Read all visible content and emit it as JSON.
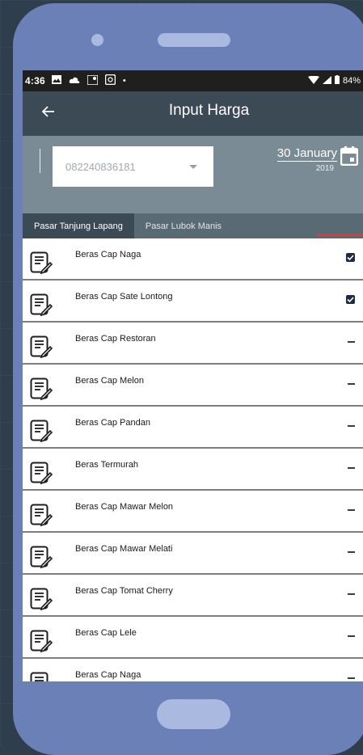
{
  "status": {
    "time": "4:36",
    "battery": "84%"
  },
  "appbar": {
    "title": "Input Harga"
  },
  "filter": {
    "phone": "082240836181",
    "date_main": "30 January",
    "date_year": "2019"
  },
  "tabs": [
    {
      "label": "Pasar Tanjung Lapang"
    },
    {
      "label": "Pasar Lubok Manis"
    }
  ],
  "items": [
    {
      "label": "Beras Cap Naga",
      "state": "checked"
    },
    {
      "label": "Beras Cap Sate Lontong",
      "state": "checked"
    },
    {
      "label": "Beras Cap Restoran",
      "state": "empty"
    },
    {
      "label": "Beras Cap Melon",
      "state": "empty"
    },
    {
      "label": "Beras Cap Pandan",
      "state": "empty"
    },
    {
      "label": "Beras Termurah",
      "state": "empty"
    },
    {
      "label": "Beras Cap Mawar Melon",
      "state": "empty"
    },
    {
      "label": "Beras Cap Mawar Melati",
      "state": "empty"
    },
    {
      "label": "Beras Cap Tomat Cherry",
      "state": "empty"
    },
    {
      "label": "Beras Cap Lele",
      "state": "empty"
    },
    {
      "label": "Beras Cap Naga",
      "state": "empty"
    }
  ],
  "colors": {
    "phone_body": "#6a80b7",
    "appbar": "#3c4a56",
    "filterbar": "#7b8b95",
    "tab_indicator": "#e7382e"
  }
}
